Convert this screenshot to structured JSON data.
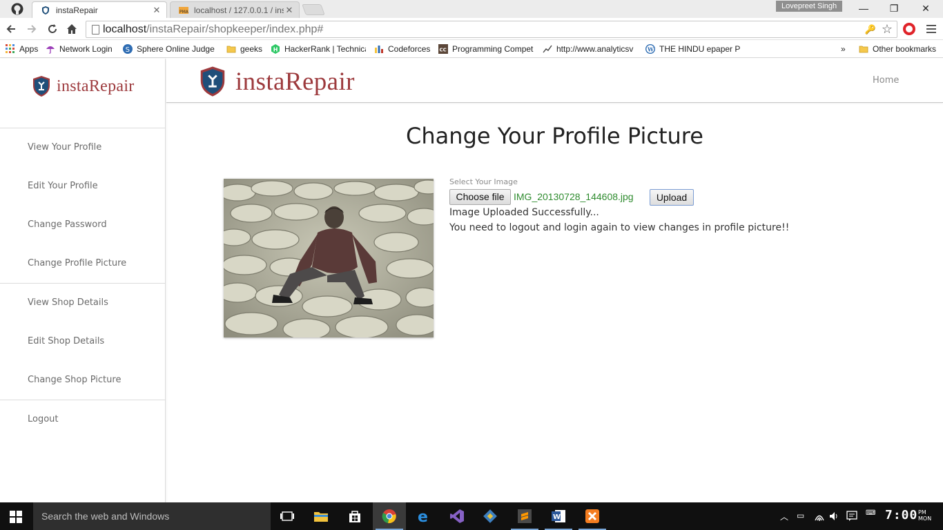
{
  "browser": {
    "tabs": [
      {
        "title": "instaRepair",
        "active": true
      },
      {
        "title": "localhost / 127.0.0.1 / inst",
        "active": false
      }
    ],
    "profile_name": "Lovepreet Singh",
    "url_host": "localhost",
    "url_path": "/instaRepair/shopkeeper/index.php#",
    "bookmarks": [
      {
        "label": "Apps",
        "icon": "apps-grid-icon"
      },
      {
        "label": "Network Login",
        "icon": "umbrella-icon"
      },
      {
        "label": "Sphere Online Judge",
        "icon": "spoj-icon"
      },
      {
        "label": "geeks",
        "icon": "folder-icon"
      },
      {
        "label": "HackerRank | Technica",
        "icon": "hackerrank-icon"
      },
      {
        "label": "Codeforces",
        "icon": "codeforces-icon"
      },
      {
        "label": "Programming Compet",
        "icon": "codechef-icon"
      },
      {
        "label": "http://www.analyticsv",
        "icon": "chart-icon"
      },
      {
        "label": "THE HINDU epaper PE",
        "icon": "wordpress-icon"
      }
    ],
    "more_bookmarks": "»",
    "other_bookmarks": "Other bookmarks"
  },
  "sidebar": {
    "brand": "instaRepair",
    "items": [
      {
        "label": "View Your Profile"
      },
      {
        "label": "Edit Your Profile"
      },
      {
        "label": "Change Password"
      },
      {
        "label": "Change Profile Picture"
      },
      {
        "label": "View Shop Details"
      },
      {
        "label": "Edit Shop Details"
      },
      {
        "label": "Change Shop Picture"
      },
      {
        "label": "Logout"
      }
    ]
  },
  "header": {
    "brand": "instaRepair",
    "home_link": "Home"
  },
  "main": {
    "title": "Change Your Profile Picture",
    "select_label": "Select Your Image",
    "choose_file_label": "Choose file",
    "file_name": "IMG_20130728_144608.jpg",
    "upload_label": "Upload",
    "success_message": "Image Uploaded Successfully...",
    "info_message": "You need to logout and login again to view changes in profile picture!!"
  },
  "taskbar": {
    "search_placeholder": "Search the web and Windows",
    "time": "7:00",
    "ampm": "PM",
    "day": "MON"
  },
  "colors": {
    "brand": "#9d3a3d",
    "shield_blue": "#1f4f7a",
    "file_name": "#2e8b2e"
  }
}
